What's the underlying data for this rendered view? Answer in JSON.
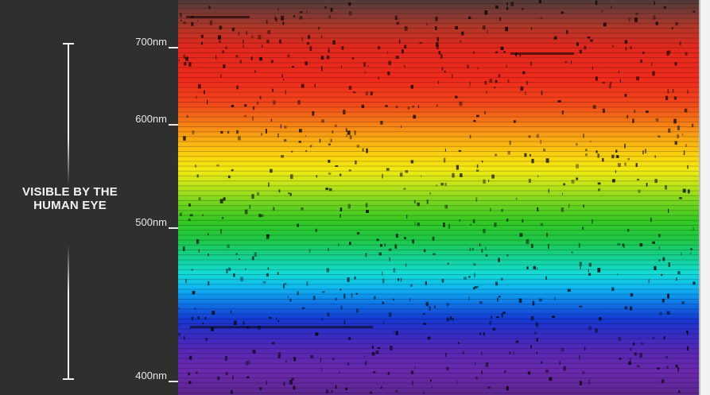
{
  "annotation": {
    "range_label": "VISIBLE BY THE HUMAN EYE"
  },
  "wavelength_ticks": [
    {
      "label": "700nm",
      "nm": 700
    },
    {
      "label": "600nm",
      "nm": 600
    },
    {
      "label": "500nm",
      "nm": 500
    },
    {
      "label": "400nm",
      "nm": 400
    }
  ],
  "colors": {
    "background": "#2f2f2f",
    "label_text": "#e8e8e8"
  }
}
